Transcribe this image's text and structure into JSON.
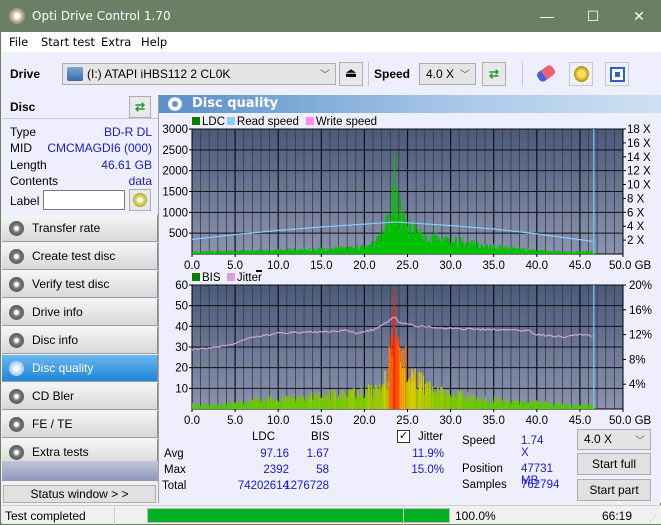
{
  "window": {
    "title": "Opti Drive Control 1.70",
    "minimize": "—",
    "maximize": "☐",
    "close": "✕"
  },
  "menu": [
    "File",
    "Start test",
    "Extra",
    "Help"
  ],
  "toolbar": {
    "drive_label": "Drive",
    "drive_value": "(I:)  ATAPI iHBS112  2 CL0K",
    "speed_label": "Speed",
    "speed_value": "4.0 X",
    "colors": {
      "accent": "#1e86d8"
    }
  },
  "disc": {
    "header": "Disc",
    "fields": [
      {
        "key": "Type",
        "value": "BD-R DL"
      },
      {
        "key": "MID",
        "value": "CMCMAGDI6 (000)"
      },
      {
        "key": "Length",
        "value": "46.61 GB"
      },
      {
        "key": "Contents",
        "value": "data"
      }
    ],
    "label_key": "Label",
    "label_value": ""
  },
  "nav": [
    {
      "label": "Transfer rate",
      "active": false
    },
    {
      "label": "Create test disc",
      "active": false
    },
    {
      "label": "Verify test disc",
      "active": false
    },
    {
      "label": "Drive info",
      "active": false
    },
    {
      "label": "Disc info",
      "active": false
    },
    {
      "label": "Disc quality",
      "active": true
    },
    {
      "label": "CD Bler",
      "active": false
    },
    {
      "label": "FE / TE",
      "active": false
    },
    {
      "label": "Extra tests",
      "active": false
    }
  ],
  "status_window_button": "Status window > >",
  "panel": {
    "title": "Disc quality"
  },
  "chart_data": [
    {
      "type": "bar",
      "title": "LDC / Read speed",
      "legend": [
        {
          "name": "LDC",
          "color": "#008000"
        },
        {
          "name": "Read speed",
          "color": "#87cefa"
        },
        {
          "name": "Write speed",
          "color": "#ff88ff"
        }
      ],
      "xlabel": "GB",
      "x_ticks": [
        "0.0",
        "5.0",
        "10.0",
        "15.0",
        "20.0",
        "25.0",
        "30.0",
        "35.0",
        "40.0",
        "45.0",
        "50.0 GB"
      ],
      "xlim": [
        0,
        50
      ],
      "y_left_ticks": [
        "500",
        "1000",
        "1500",
        "2000",
        "2500",
        "3000"
      ],
      "ylim_left": [
        0,
        3000
      ],
      "y_right_ticks": [
        "2 X",
        "4 X",
        "6 X",
        "8 X",
        "10 X",
        "12 X",
        "14 X",
        "16 X",
        "18 X"
      ],
      "ylim_right": [
        0,
        18
      ],
      "disc_end_gb": 46.61,
      "series": [
        {
          "name": "LDC",
          "points": [
            [
              0,
              60
            ],
            [
              2,
              50
            ],
            [
              4,
              60
            ],
            [
              6,
              70
            ],
            [
              8,
              80
            ],
            [
              10,
              90
            ],
            [
              12,
              100
            ],
            [
              14,
              110
            ],
            [
              16,
              120
            ],
            [
              18,
              140
            ],
            [
              20,
              170
            ],
            [
              21,
              230
            ],
            [
              22,
              400
            ],
            [
              22.8,
              800
            ],
            [
              23.3,
              1300
            ],
            [
              23.4,
              2392
            ],
            [
              23.6,
              1200
            ],
            [
              24,
              1000
            ],
            [
              24.5,
              800
            ],
            [
              25,
              600
            ],
            [
              26,
              500
            ],
            [
              27,
              420
            ],
            [
              28,
              380
            ],
            [
              30,
              320
            ],
            [
              32,
              260
            ],
            [
              34,
              200
            ],
            [
              36,
              160
            ],
            [
              38,
              120
            ],
            [
              40,
              80
            ],
            [
              42,
              60
            ],
            [
              44,
              50
            ],
            [
              46.6,
              60
            ]
          ]
        },
        {
          "name": "Read speed",
          "points": [
            [
              0,
              2.1
            ],
            [
              5,
              2.8
            ],
            [
              10,
              3.4
            ],
            [
              15,
              3.9
            ],
            [
              20,
              4.3
            ],
            [
              23.4,
              4.6
            ],
            [
              25,
              4.5
            ],
            [
              30,
              4.1
            ],
            [
              35,
              3.6
            ],
            [
              40,
              2.9
            ],
            [
              46.6,
              1.8
            ]
          ]
        }
      ]
    },
    {
      "type": "bar",
      "title": "BIS / Jitter",
      "legend": [
        {
          "name": "BIS",
          "color": "#008000"
        },
        {
          "name": "Jitter",
          "color": "#d8a0d8"
        }
      ],
      "xlabel": "GB",
      "x_ticks": [
        "0.0",
        "5.0",
        "10.0",
        "15.0",
        "20.0",
        "25.0",
        "30.0",
        "35.0",
        "40.0",
        "45.0",
        "50.0 GB"
      ],
      "xlim": [
        0,
        50
      ],
      "y_left_ticks": [
        "10",
        "20",
        "30",
        "40",
        "50",
        "60"
      ],
      "ylim_left": [
        0,
        60
      ],
      "y_right_ticks": [
        "4%",
        "8%",
        "12%",
        "16%",
        "20%"
      ],
      "ylim_right": [
        0,
        20
      ],
      "disc_end_gb": 46.61,
      "series": [
        {
          "name": "BIS",
          "points": [
            [
              0,
              2
            ],
            [
              3,
              2
            ],
            [
              5,
              3
            ],
            [
              8,
              4
            ],
            [
              10,
              5
            ],
            [
              14,
              6
            ],
            [
              18,
              7
            ],
            [
              20,
              8
            ],
            [
              21.5,
              10
            ],
            [
              22.5,
              16
            ],
            [
              23,
              25
            ],
            [
              23.3,
              38
            ],
            [
              23.4,
              58
            ],
            [
              23.6,
              30
            ],
            [
              24,
              26
            ],
            [
              25,
              20
            ],
            [
              26,
              14
            ],
            [
              27,
              11
            ],
            [
              28,
              9
            ],
            [
              30,
              7
            ],
            [
              33,
              5
            ],
            [
              36,
              4
            ],
            [
              40,
              3
            ],
            [
              43,
              2
            ],
            [
              46.6,
              2
            ]
          ]
        },
        {
          "name": "Jitter",
          "points": [
            [
              0,
              9.6
            ],
            [
              3,
              10
            ],
            [
              5,
              10.6
            ],
            [
              7,
              11.6
            ],
            [
              10,
              12.2
            ],
            [
              15,
              12.4
            ],
            [
              18,
              12.7
            ],
            [
              19,
              12.2
            ],
            [
              21,
              12.8
            ],
            [
              22.5,
              13.8
            ],
            [
              23.4,
              15.0
            ],
            [
              24,
              14
            ],
            [
              26,
              13.4
            ],
            [
              30,
              13.0
            ],
            [
              35,
              12.8
            ],
            [
              39,
              12.6
            ],
            [
              40,
              12.0
            ],
            [
              43,
              11.6
            ],
            [
              45,
              12.0
            ],
            [
              46.6,
              11.8
            ]
          ]
        }
      ]
    }
  ],
  "stats": {
    "col_ldc": "LDC",
    "col_bis": "BIS",
    "jitter_checked": true,
    "jitter_label": "Jitter",
    "rows": [
      {
        "label": "Avg",
        "ldc": "97.16",
        "bis": "1.67",
        "jitter": "11.9%"
      },
      {
        "label": "Max",
        "ldc": "2392",
        "bis": "58",
        "jitter": "15.0%"
      },
      {
        "label": "Total",
        "ldc": "74202614",
        "bis": "1276728",
        "jitter": ""
      }
    ],
    "speed_label": "Speed",
    "speed_value": "1.74 X",
    "position_label": "Position",
    "position_value": "47731 MB",
    "samples_label": "Samples",
    "samples_value": "762794",
    "speed_select": "4.0 X",
    "start_full": "Start full",
    "start_part": "Start part"
  },
  "status": {
    "text": "Test completed",
    "progress": 1.0,
    "progress_text": "100.0%",
    "elapsed": "66:19",
    "progress_color": "#06b025"
  }
}
